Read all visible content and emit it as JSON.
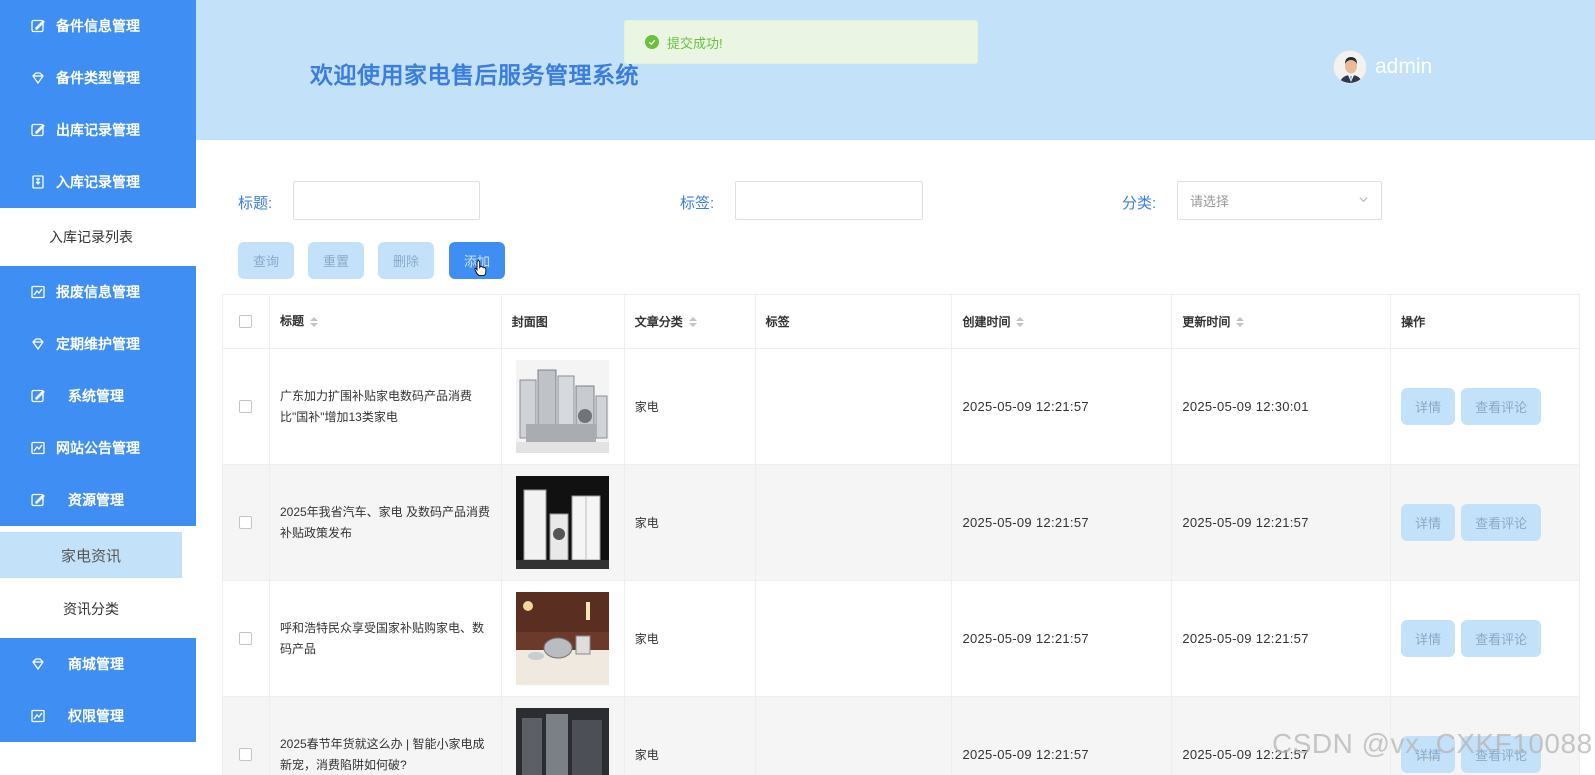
{
  "sidebar": {
    "groups_top": [
      {
        "label": "备件信息管理",
        "icon": "edit-icon"
      },
      {
        "label": "备件类型管理",
        "icon": "gem-icon"
      },
      {
        "label": "出库记录管理",
        "icon": "edit-icon"
      },
      {
        "label": "入库记录管理",
        "icon": "archive-icon"
      }
    ],
    "sub_inbound": "入库记录列表",
    "groups_mid": [
      {
        "label": "报废信息管理",
        "icon": "chart-icon"
      },
      {
        "label": "定期维护管理",
        "icon": "gem-icon"
      },
      {
        "label": "系统管理",
        "icon": "edit-icon"
      },
      {
        "label": "网站公告管理",
        "icon": "chart-icon"
      },
      {
        "label": "资源管理",
        "icon": "edit-icon"
      }
    ],
    "sub_resource": [
      "家电资讯",
      "资讯分类"
    ],
    "groups_bottom": [
      {
        "label": "商城管理",
        "icon": "gem-icon"
      },
      {
        "label": "权限管理",
        "icon": "chart-icon"
      }
    ]
  },
  "header": {
    "title": "欢迎使用家电售后服务管理系统",
    "username": "admin"
  },
  "toast": {
    "text": "提交成功!"
  },
  "search": {
    "title_label": "标题:",
    "tag_label": "标签:",
    "category_label": "分类:",
    "category_placeholder": "请选择"
  },
  "actions": {
    "query": "查询",
    "reset": "重置",
    "delete": "删除",
    "add": "添加"
  },
  "table": {
    "headers": {
      "title": "标题",
      "cover": "封面图",
      "category": "文章分类",
      "tag": "标签",
      "created": "创建时间",
      "updated": "更新时间",
      "ops": "操作"
    },
    "rows": [
      {
        "title": "广东加力扩围补贴家电数码产品消费比\"国补\"增加13类家电",
        "category": "家电",
        "tag": "",
        "created": "2025-05-09 12:21:57",
        "updated": "2025-05-09 12:30:01"
      },
      {
        "title": "2025年我省汽车、家电 及数码产品消费补贴政策发布",
        "category": "家电",
        "tag": "",
        "created": "2025-05-09 12:21:57",
        "updated": "2025-05-09 12:21:57"
      },
      {
        "title": "呼和浩特民众享受国家补贴购家电、数码产品",
        "category": "家电",
        "tag": "",
        "created": "2025-05-09 12:21:57",
        "updated": "2025-05-09 12:21:57"
      },
      {
        "title": "2025春节年货就这么办 | 智能小家电成新宠，消费陷阱如何破?",
        "category": "家电",
        "tag": "",
        "created": "2025-05-09 12:21:57",
        "updated": "2025-05-09 12:21:57"
      }
    ],
    "op_detail": "详情",
    "op_comments": "查看评论"
  },
  "watermark": "CSDN @vx_CXKF10088",
  "colors": {
    "sidebar_blue": "#3f8ef3",
    "light_blue": "#c3e2fa",
    "title_blue": "#3b7ee0",
    "success_green": "#67c23a"
  }
}
